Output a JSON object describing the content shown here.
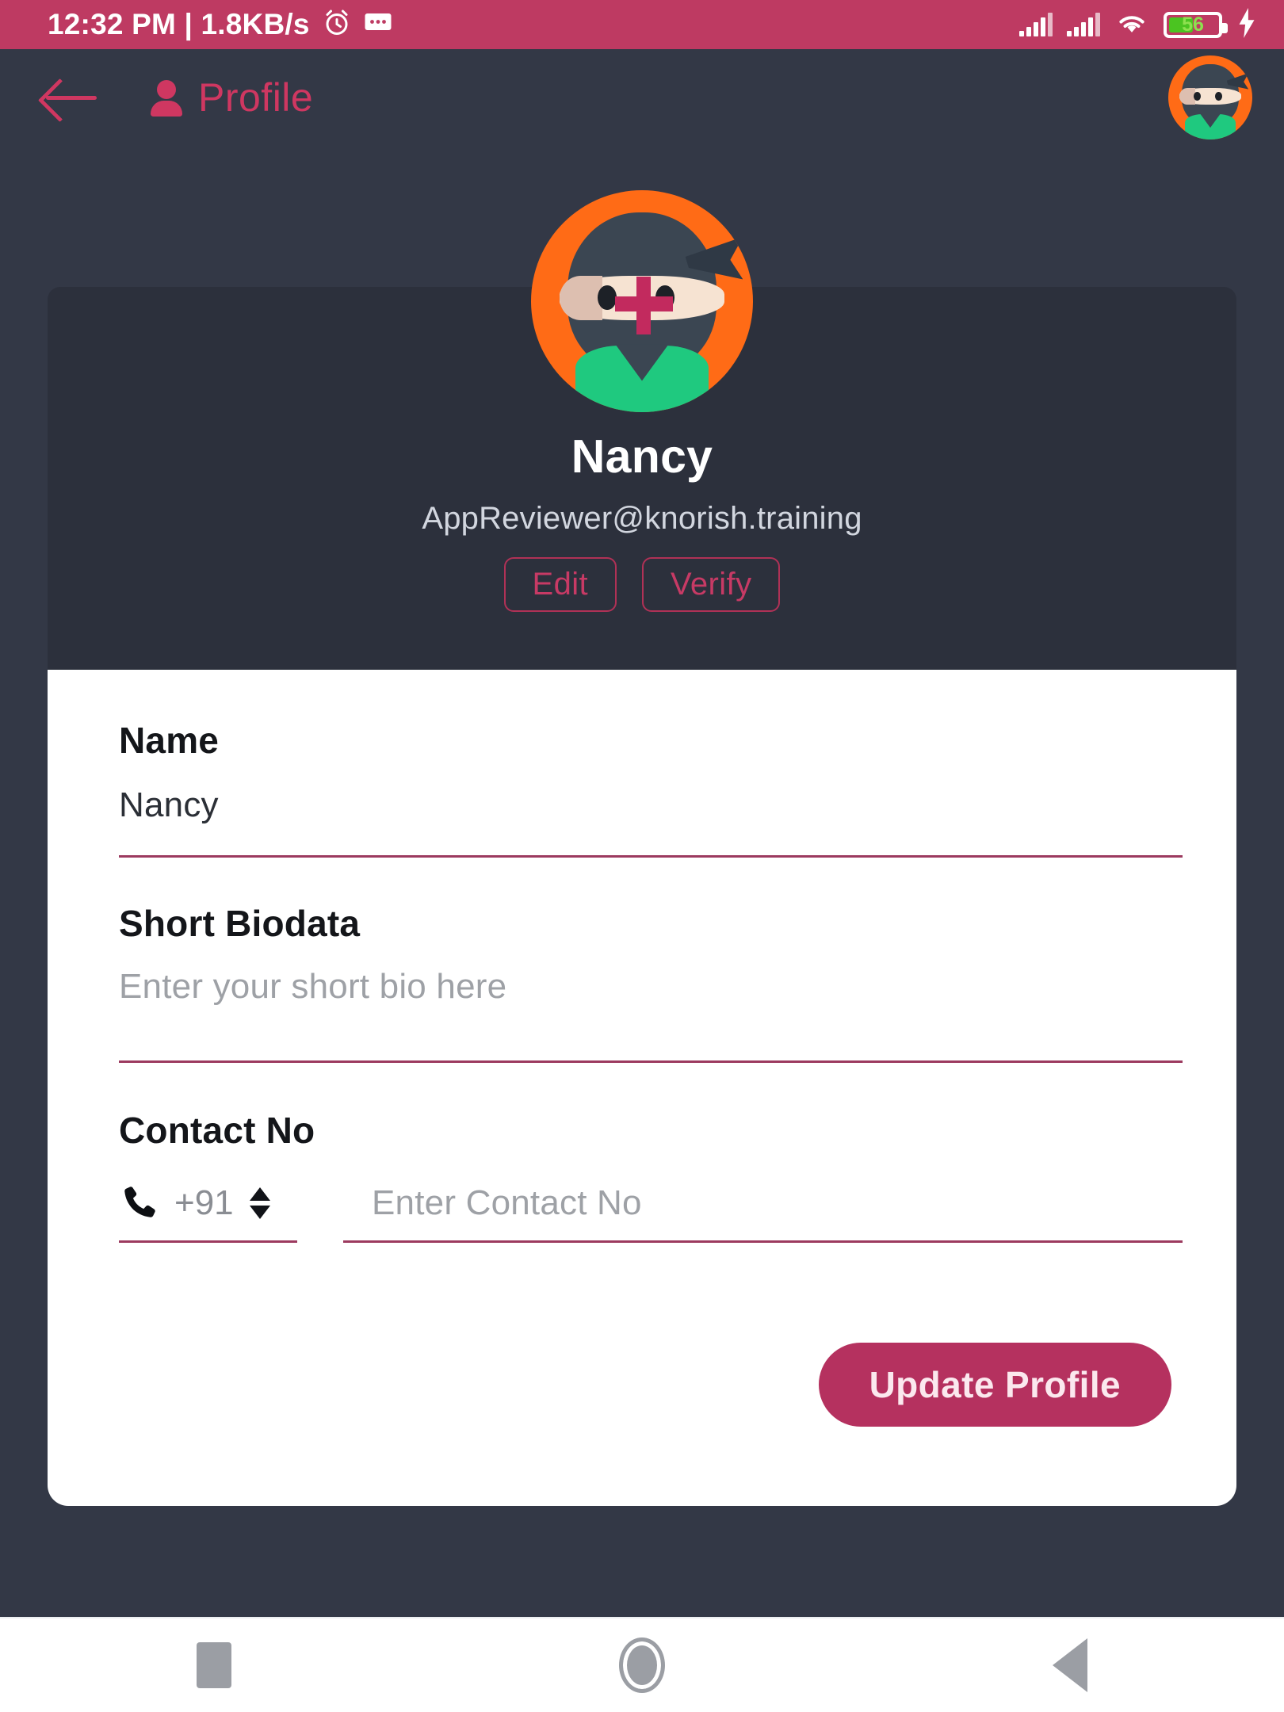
{
  "status_bar": {
    "clock": "12:32 PM | 1.8KB/s",
    "alarm_icon": "alarm-icon",
    "message_icon": "message-icon",
    "signal_icon_1": "signal-bars-icon",
    "signal_icon_2": "signal-bars-icon",
    "wifi_icon": "wifi-icon",
    "battery_level": "56",
    "charging_icon": "charging-bolt-icon",
    "background_color": "#be3a62"
  },
  "app_bar": {
    "back_icon": "back-arrow-icon",
    "person_icon": "person-icon",
    "title": "Profile",
    "avatar_icon": "ninja-avatar-icon",
    "accent_color": "#cf3761"
  },
  "profile": {
    "avatar_icon": "ninja-avatar-icon",
    "name": "Nancy",
    "email": "AppReviewer@knorish.training",
    "edit_label": "Edit",
    "verify_label": "Verify",
    "card_color": "#2c303c"
  },
  "form": {
    "name_field": {
      "label": "Name",
      "value": "Nancy"
    },
    "bio_field": {
      "label": "Short Biodata",
      "placeholder": "Enter your short bio here",
      "value": ""
    },
    "contact_field": {
      "label": "Contact No",
      "phone_icon": "phone-icon",
      "country_code": "+91",
      "stepper_icon": "updown-stepper-icon",
      "placeholder": "Enter Contact No",
      "value": ""
    },
    "submit_label": "Update Profile",
    "accent_color": "#b5315f",
    "underline_color": "#9c3a5f"
  },
  "nav_bar": {
    "recents_icon": "square-recents-icon",
    "home_icon": "circle-home-icon",
    "back_icon": "triangle-back-icon"
  }
}
